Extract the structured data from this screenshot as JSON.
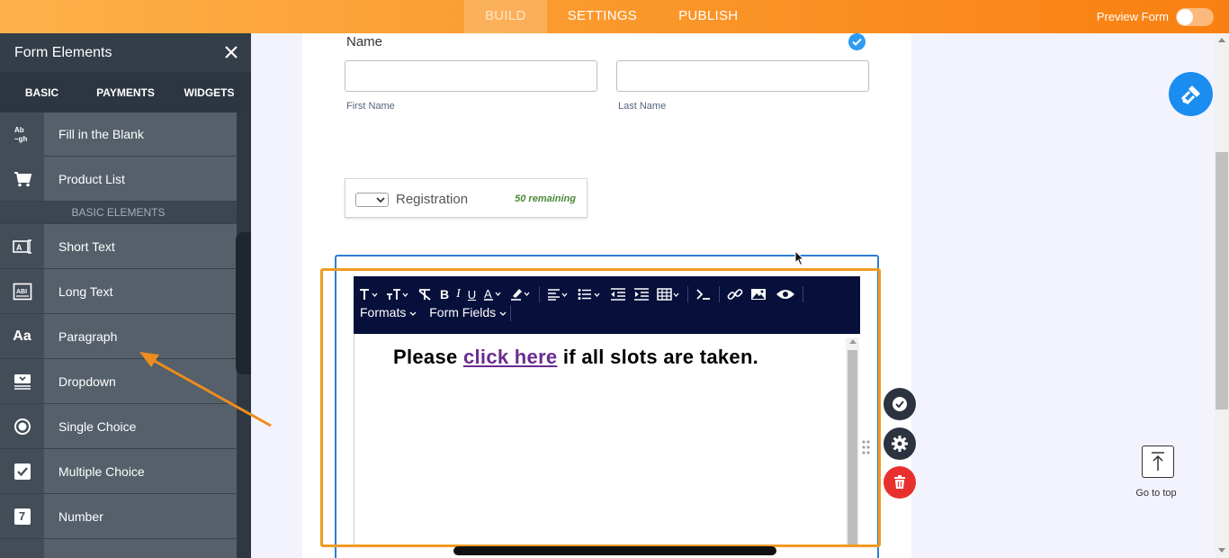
{
  "topbar": {
    "tabs": [
      {
        "label": "BUILD",
        "active": true
      },
      {
        "label": "SETTINGS",
        "active": false
      },
      {
        "label": "PUBLISH",
        "active": false
      }
    ],
    "preview_label": "Preview Form",
    "preview_enabled": false,
    "gradient_colors": [
      "#fdb14b",
      "#f97f11"
    ]
  },
  "sidebar": {
    "title": "Form Elements",
    "tabs": [
      {
        "label": "BASIC",
        "active": true
      },
      {
        "label": "PAYMENTS",
        "active": false
      },
      {
        "label": "WIDGETS",
        "active": false
      }
    ],
    "items_top": [
      {
        "label": "Fill in the Blank",
        "icon": "fill-blank-icon",
        "icon_text": "Ab ~gh"
      },
      {
        "label": "Product List",
        "icon": "cart-icon"
      }
    ],
    "section_label": "BASIC ELEMENTS",
    "items": [
      {
        "label": "Short Text",
        "icon": "short-text-icon"
      },
      {
        "label": "Long Text",
        "icon": "long-text-icon"
      },
      {
        "label": "Paragraph",
        "icon": "paragraph-icon",
        "icon_text": "Aa"
      },
      {
        "label": "Dropdown",
        "icon": "dropdown-icon"
      },
      {
        "label": "Single Choice",
        "icon": "radio-icon"
      },
      {
        "label": "Multiple Choice",
        "icon": "checkbox-icon"
      },
      {
        "label": "Number",
        "icon": "number-icon",
        "icon_text": "7"
      }
    ]
  },
  "form": {
    "name_label": "Name",
    "first_name_sublabel": "First Name",
    "last_name_sublabel": "Last Name",
    "registration": {
      "label": "Registration",
      "remaining": "50 remaining"
    },
    "editor": {
      "menus": [
        "Formats",
        "Form Fields"
      ],
      "text_before": "Please ",
      "link_text": "click here",
      "text_after": " if all slots are taken."
    }
  },
  "right": {
    "go_to_top_label": "Go to top"
  },
  "colors": {
    "accent_orange": "#f09b22",
    "selection_blue": "#2d7fd4",
    "toolbar_navy": "#06103b",
    "delete_red": "#e8312f",
    "wand_blue": "#1b8cf0"
  }
}
